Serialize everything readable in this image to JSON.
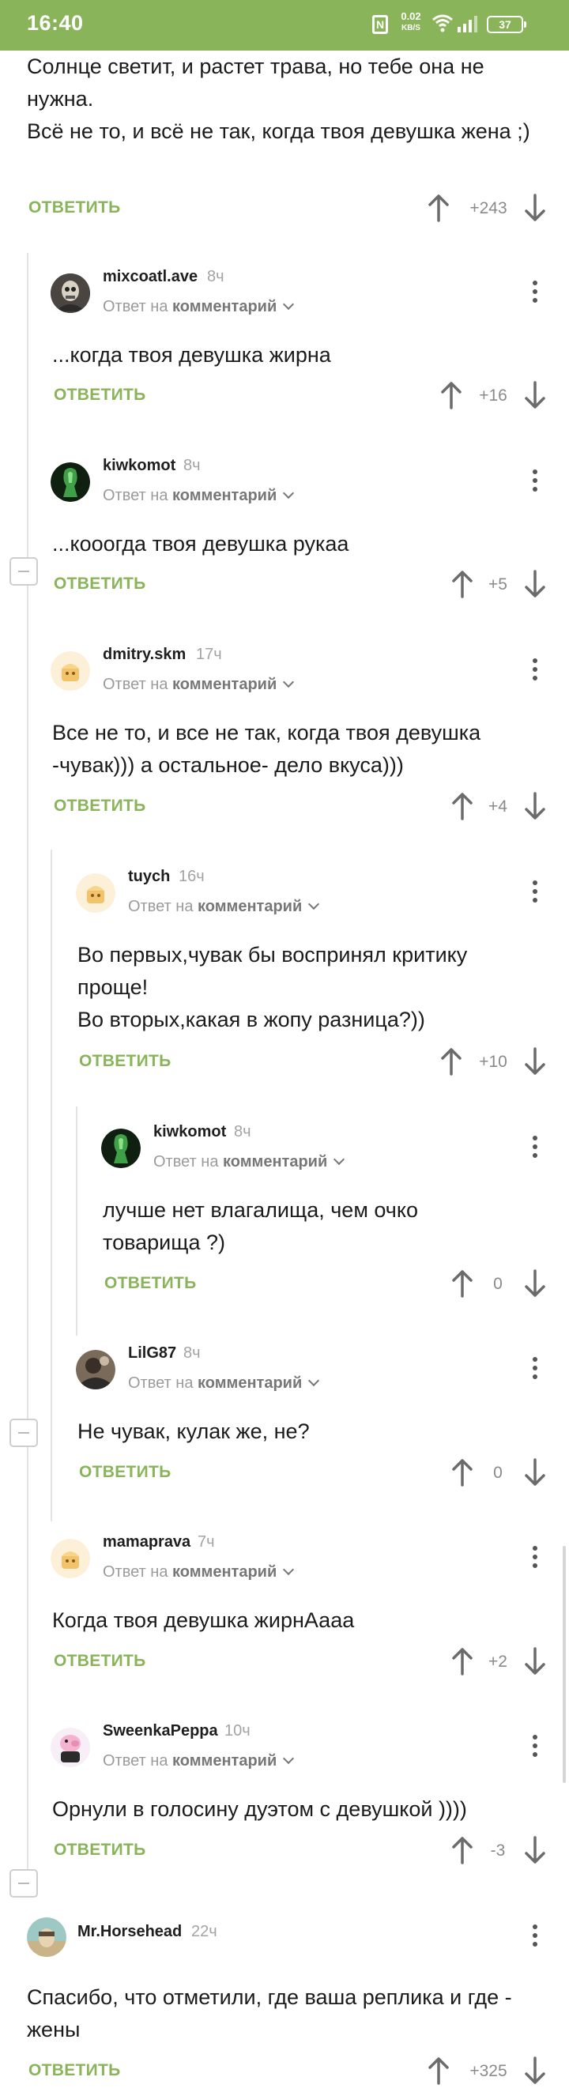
{
  "status_bar": {
    "time": "16:40",
    "nfc": "N",
    "net_speed": "0.02",
    "net_unit": "KB/S",
    "battery": "37",
    "color": "#8ab45a"
  },
  "labels": {
    "reply": "ОТВЕТИТЬ",
    "reply_to": "Ответ на",
    "reply_to_link": "комментарий"
  },
  "top_comment": {
    "text": "Солнце светит, и растет трава, но тебе она не нужна.\nВсё не то, и всё не так, когда твоя девушка жена ;)",
    "score": "+243"
  },
  "comments": [
    {
      "user": "mixcoatl.ave",
      "time": "8ч",
      "text": "...когда твоя девушка жирна",
      "score": "+16"
    },
    {
      "user": "kiwkomot",
      "time": "8ч",
      "text": "...кооогда твоя девушка рукаа",
      "score": "+5"
    },
    {
      "user": "dmitry.skm",
      "time": "17ч",
      "text": "Все не то, и все не так, когда твоя девушка -чувак))) а остальное- дело вкуса)))",
      "score": "+4"
    },
    {
      "user": "tuych",
      "time": "16ч",
      "text": "Во первых,чувак бы воспринял критику проще!\nВо вторых,какая в жопу разница?))",
      "score": "+10"
    },
    {
      "user": "kiwkomot",
      "time": "8ч",
      "text": "лучше нет влагалища, чем очко товарища ?)",
      "score": "0"
    },
    {
      "user": "LilG87",
      "time": "8ч",
      "text": "Не чувак, кулак же, не?",
      "score": "0"
    },
    {
      "user": "mamaprava",
      "time": "7ч",
      "text": "Когда твоя девушка жирнАааа",
      "score": "+2"
    },
    {
      "user": "SweenkaPeppa",
      "time": "10ч",
      "text": "Орнули в голосину дуэтом с девушкой ))))",
      "score": "-3"
    }
  ],
  "last_comment": {
    "user": "Mr.Horsehead",
    "time": "22ч",
    "text": "Спасибо, что отметили, где ваша реплика и где - жены",
    "score": "+325"
  }
}
